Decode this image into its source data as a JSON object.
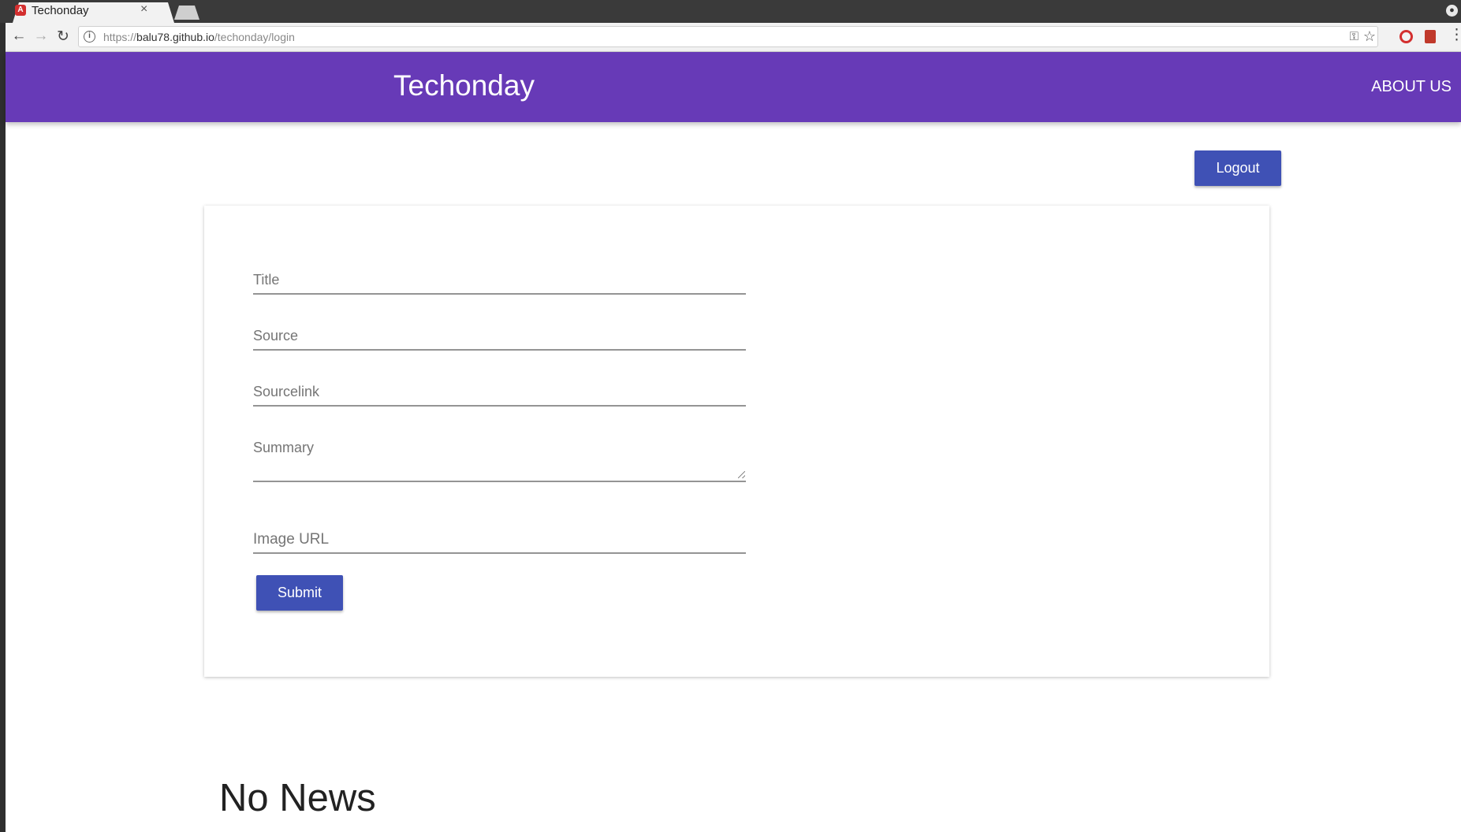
{
  "browser": {
    "tab_title": "Techonday",
    "favicon_letter": "A",
    "tab_close": "×",
    "url_scheme": "https://",
    "url_host": "balu78.github.io",
    "url_path": "/techonday/login"
  },
  "header": {
    "title": "Techonday",
    "about_label": "ABOUT US"
  },
  "actions": {
    "logout_label": "Logout"
  },
  "form": {
    "title_placeholder": "Title",
    "source_placeholder": "Source",
    "sourcelink_placeholder": "Sourcelink",
    "summary_placeholder": "Summary",
    "image_url_placeholder": "Image URL",
    "submit_label": "Submit"
  },
  "news": {
    "empty_message": "No News"
  },
  "colors": {
    "header_bg": "#673ab7",
    "button_bg": "#3f51b5"
  }
}
